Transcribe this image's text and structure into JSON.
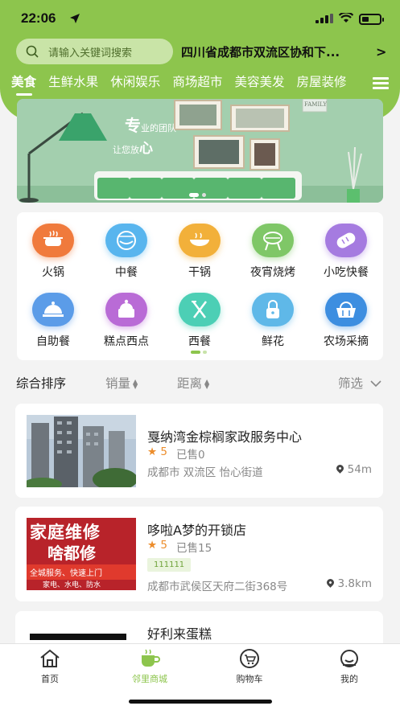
{
  "status": {
    "time": "22:06"
  },
  "search": {
    "placeholder": "请输入关键词搜索"
  },
  "location": {
    "address": "四川省成都市双流区协和下..."
  },
  "tabs": [
    "美食",
    "生鲜水果",
    "休闲娱乐",
    "商场超市",
    "美容美发",
    "房屋装修"
  ],
  "banner": {
    "text_big1": "专",
    "text_small1": "业的团队",
    "text_small2": "让您放",
    "text_big2": "心",
    "frame_label": "FAMILY"
  },
  "categories": [
    {
      "label": "火锅",
      "icon": "hotpot-icon",
      "color": "#f07a3c"
    },
    {
      "label": "中餐",
      "icon": "bowl-icon",
      "color": "#58b5ee"
    },
    {
      "label": "干锅",
      "icon": "drypot-icon",
      "color": "#f2b03a"
    },
    {
      "label": "夜宵烧烤",
      "icon": "bbq-icon",
      "color": "#7fc767"
    },
    {
      "label": "小吃快餐",
      "icon": "bread-icon",
      "color": "#a57be0"
    },
    {
      "label": "自助餐",
      "icon": "dome-icon",
      "color": "#5b9ce8"
    },
    {
      "label": "糕点西点",
      "icon": "cake-icon",
      "color": "#b96bd6"
    },
    {
      "label": "西餐",
      "icon": "cutlery-icon",
      "color": "#4ccfb5"
    },
    {
      "label": "鲜花",
      "icon": "lock-icon",
      "color": "#5fb8e8"
    },
    {
      "label": "农场采摘",
      "icon": "basket-icon",
      "color": "#3d8ee0"
    }
  ],
  "sort": {
    "comprehensive": "综合排序",
    "sales": "销量",
    "distance": "距离",
    "filter": "筛选"
  },
  "stores": [
    {
      "name": "戛纳湾金棕榈家政服务中心",
      "rating": "5",
      "sold": "已售0",
      "address": "成都市 双流区 怡心街道",
      "distance": "54m"
    },
    {
      "name": "哆啦A梦的开锁店",
      "rating": "5",
      "sold": "已售15",
      "tag": "111111",
      "address": "成都市武侯区天府二街368号",
      "distance": "3.8km",
      "img_line1": "家庭维修",
      "img_line2": "啥都修",
      "img_line3": "全城服务、快速上门",
      "img_line4": "家电、水电、防水"
    },
    {
      "name": "好利来蛋糕"
    }
  ],
  "tabbar": [
    {
      "label": "首页",
      "icon": "home-icon"
    },
    {
      "label": "邻里商城",
      "icon": "coffee-cup-icon"
    },
    {
      "label": "购物车",
      "icon": "cart-icon"
    },
    {
      "label": "我的",
      "icon": "profile-icon"
    }
  ],
  "colors": {
    "brand": "#8dc54d",
    "rating": "#ec8d2c"
  }
}
